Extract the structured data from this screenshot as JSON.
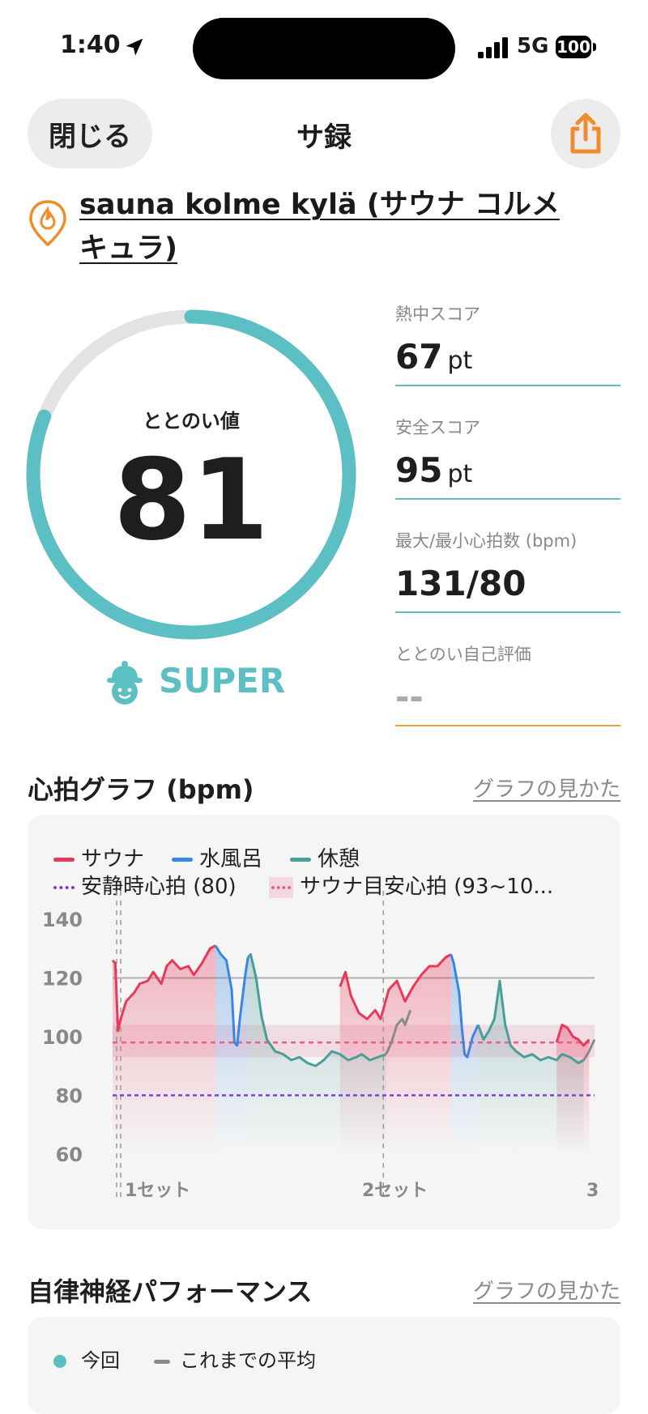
{
  "status_bar": {
    "time": "1:40",
    "network": "5G",
    "battery": "100"
  },
  "nav": {
    "close_label": "閉じる",
    "title": "サ録"
  },
  "facility": {
    "name": "sauna kolme kylä (サウナ コルメキュラ)"
  },
  "gauge": {
    "label": "ととのい値",
    "value": "81",
    "level": 0.81,
    "rank": "SUPER"
  },
  "stats": [
    {
      "label": "熱中スコア",
      "value": "67",
      "unit": "pt"
    },
    {
      "label": "安全スコア",
      "value": "95",
      "unit": "pt"
    },
    {
      "label": "最大/最小心拍数 (bpm)",
      "value": "131/80",
      "unit": ""
    },
    {
      "label": "ととのい自己評価",
      "value": "--",
      "unit": ""
    }
  ],
  "heart_section": {
    "title": "心拍グラフ (bpm)",
    "link": "グラフの見かた"
  },
  "legend": {
    "sauna": "サウナ",
    "cold": "水風呂",
    "rest": "休憩",
    "resting_hr": "安静時心拍 (80)",
    "sauna_target": "サウナ目安心拍 (93~10..."
  },
  "colors": {
    "sauna": "#e8395a",
    "cold": "#3a86e0",
    "rest": "#4a9e98",
    "neutral": "#8a8a8a",
    "resting": "#7b3fe0",
    "target": "#e8608a",
    "accent": "#5bbfc3",
    "orange": "#f08c2c"
  },
  "chart_data": {
    "type": "line",
    "ylim": [
      60,
      140
    ],
    "yticks": [
      "140",
      "120",
      "100",
      "80",
      "60"
    ],
    "set_labels": [
      "1セット",
      "2セット",
      "3"
    ],
    "resting_hr": 80,
    "target_band": [
      93,
      104
    ],
    "reference_line": 120,
    "series": [
      {
        "name": "サウナ",
        "segments": [
          [
            [
              0,
              126
            ],
            [
              1,
              125
            ],
            [
              2,
              102
            ],
            [
              3,
              106
            ],
            [
              5,
              112
            ],
            [
              8,
              115
            ],
            [
              10,
              118
            ],
            [
              13,
              119
            ],
            [
              15,
              122
            ],
            [
              18,
              118
            ],
            [
              20,
              124
            ],
            [
              22,
              126
            ],
            [
              25,
              123
            ],
            [
              28,
              124
            ],
            [
              30,
              121
            ],
            [
              33,
              125
            ],
            [
              36,
              130
            ],
            [
              38,
              131
            ]
          ],
          [
            [
              84,
              117
            ],
            [
              86,
              122
            ],
            [
              88,
              114
            ],
            [
              91,
              108
            ],
            [
              94,
              106
            ],
            [
              97,
              109
            ],
            [
              99,
              106
            ],
            [
              102,
              116
            ],
            [
              105,
              119
            ],
            [
              108,
              112
            ],
            [
              111,
              117
            ],
            [
              114,
              121
            ],
            [
              117,
              124
            ],
            [
              120,
              124
            ],
            [
              123,
              127
            ],
            [
              125,
              128
            ]
          ],
          [
            [
              164,
              98
            ],
            [
              166,
              104
            ],
            [
              168,
              103
            ],
            [
              170,
              100
            ],
            [
              172,
              99
            ],
            [
              174,
              97
            ],
            [
              176,
              99
            ]
          ]
        ]
      },
      {
        "name": "水風呂",
        "segments": [
          [
            [
              38,
              131
            ],
            [
              40,
              128
            ],
            [
              42,
              126
            ],
            [
              44,
              116
            ],
            [
              45,
              98
            ],
            [
              46,
              97
            ],
            [
              47,
              106
            ],
            [
              49,
              121
            ],
            [
              50,
              127
            ]
          ],
          [
            [
              125,
              128
            ],
            [
              126,
              125
            ],
            [
              128,
              115
            ],
            [
              129,
              103
            ],
            [
              130,
              94
            ],
            [
              131,
              93
            ],
            [
              133,
              100
            ],
            [
              135,
              104
            ]
          ]
        ]
      },
      {
        "name": "休憩",
        "segments": [
          [
            [
              50,
              127
            ],
            [
              51,
              128
            ],
            [
              53,
              120
            ],
            [
              55,
              107
            ],
            [
              57,
              99
            ],
            [
              60,
              95
            ],
            [
              63,
              94
            ],
            [
              66,
              92
            ],
            [
              69,
              93
            ],
            [
              72,
              91
            ],
            [
              75,
              90
            ],
            [
              78,
              92
            ],
            [
              81,
              95
            ],
            [
              84,
              94
            ],
            [
              87,
              92
            ],
            [
              90,
              93
            ],
            [
              92,
              94
            ],
            [
              95,
              92
            ],
            [
              98,
              93
            ],
            [
              101,
              94
            ]
          ],
          [
            [
              135,
              104
            ],
            [
              137,
              99
            ],
            [
              139,
              102
            ],
            [
              141,
              106
            ],
            [
              143,
              119
            ],
            [
              145,
              104
            ],
            [
              147,
              97
            ],
            [
              149,
              95
            ],
            [
              152,
              93
            ],
            [
              155,
              94
            ],
            [
              158,
              92
            ],
            [
              161,
              93
            ],
            [
              164,
              92
            ],
            [
              166,
              94
            ],
            [
              169,
              93
            ],
            [
              172,
              91
            ],
            [
              174,
              92
            ]
          ]
        ]
      },
      {
        "name": "neutral",
        "segments": [
          [
            [
              101,
              94
            ],
            [
              103,
              98
            ],
            [
              105,
              104
            ],
            [
              107,
              106
            ],
            [
              108,
              104
            ],
            [
              110,
              109
            ]
          ],
          [
            [
              174,
              92
            ],
            [
              176,
              95
            ],
            [
              178,
              99
            ]
          ]
        ]
      }
    ]
  },
  "autonomic_section": {
    "title": "自律神経パフォーマンス",
    "link": "グラフの見かた"
  },
  "autonomic_legend": {
    "current": "今回",
    "average": "これまでの平均"
  }
}
